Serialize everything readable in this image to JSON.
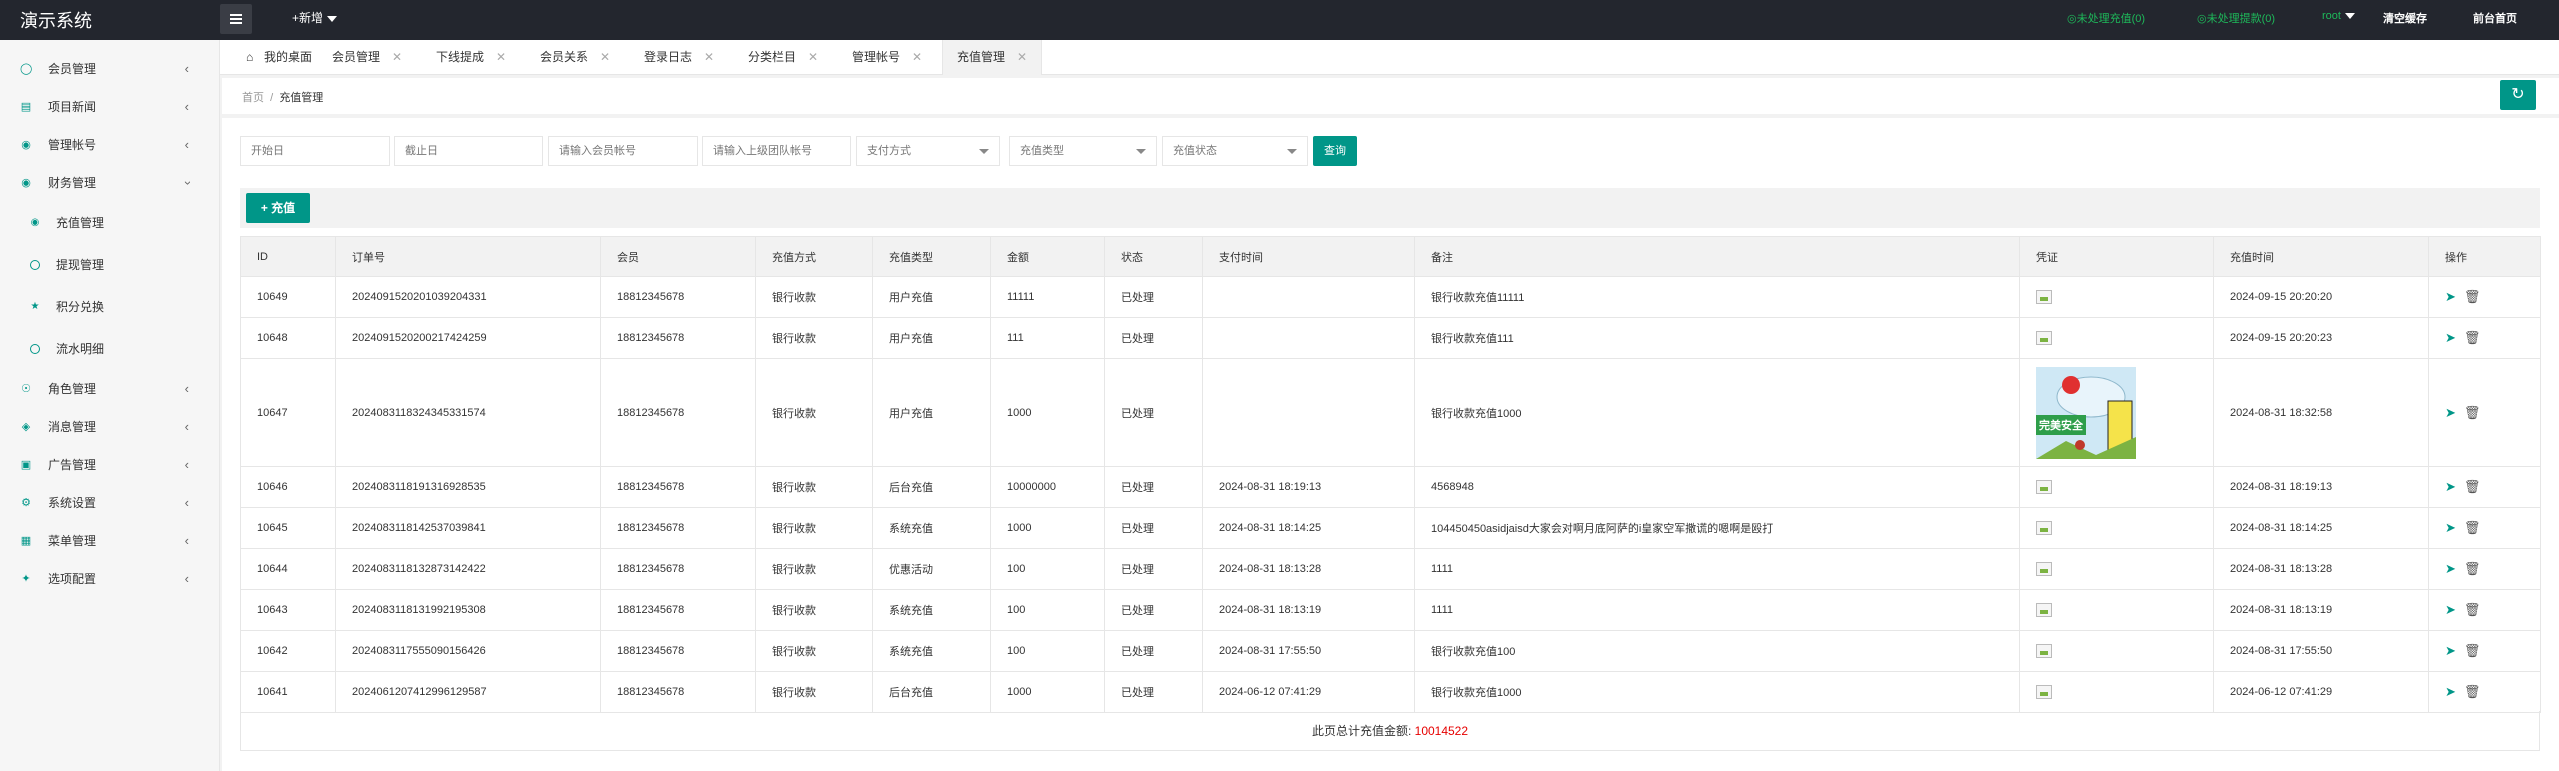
{
  "app": {
    "title": "演示系统"
  },
  "topbar": {
    "add_new": "+新增",
    "unprocessed_recharge": "◎未处理充值(0)",
    "unprocessed_withdraw": "◎未处理提款(0)",
    "user": "root",
    "clear_cache": "清空缓存",
    "frontend_home": "前台首页"
  },
  "sidebar": {
    "items": [
      {
        "label": "会员管理",
        "icon": "user-icon"
      },
      {
        "label": "项目新闻",
        "icon": "book-icon"
      },
      {
        "label": "管理帐号",
        "icon": "account-icon"
      },
      {
        "label": "财务管理",
        "icon": "finance-icon"
      },
      {
        "label": "角色管理",
        "icon": "shield-icon"
      },
      {
        "label": "消息管理",
        "icon": "message-icon"
      },
      {
        "label": "广告管理",
        "icon": "ad-icon"
      },
      {
        "label": "系统设置",
        "icon": "gear-icon"
      },
      {
        "label": "菜单管理",
        "icon": "menu-icon"
      },
      {
        "label": "选项配置",
        "icon": "options-icon"
      }
    ],
    "finance_sub": [
      {
        "label": "充值管理",
        "icon": "recharge-icon"
      },
      {
        "label": "提现管理",
        "icon": "withdraw-icon"
      },
      {
        "label": "积分兑换",
        "icon": "star-icon"
      },
      {
        "label": "流水明细",
        "icon": "flow-icon"
      }
    ]
  },
  "tabs": [
    {
      "label": "我的桌面"
    },
    {
      "label": "会员管理"
    },
    {
      "label": "下线提成"
    },
    {
      "label": "会员关系"
    },
    {
      "label": "登录日志"
    },
    {
      "label": "分类栏目"
    },
    {
      "label": "管理帐号"
    },
    {
      "label": "充值管理"
    }
  ],
  "breadcrumb": {
    "home": "首页",
    "sep": "/",
    "current": "充值管理"
  },
  "filters": {
    "start_date": "开始日",
    "end_date": "截止日",
    "member_account": "请输入会员帐号",
    "parent_account": "请输入上级团队帐号",
    "pay_method": "支付方式",
    "recharge_type": "充值类型",
    "recharge_status": "充值状态",
    "query": "查询"
  },
  "add_button": "充值",
  "table": {
    "headers": [
      "ID",
      "订单号",
      "会员",
      "充值方式",
      "充值类型",
      "金额",
      "状态",
      "支付时间",
      "备注",
      "凭证",
      "充值时间",
      "操作"
    ],
    "rows": [
      {
        "id": "10649",
        "order": "2024091520201039204331",
        "member": "18812345678",
        "method": "银行收款",
        "type": "用户充值",
        "amount": "11111",
        "status": "已处理",
        "pay_time": "",
        "note": "银行收款充值11111",
        "recharge_time": "2024-09-15 20:20:20"
      },
      {
        "id": "10648",
        "order": "2024091520200217424259",
        "member": "18812345678",
        "method": "银行收款",
        "type": "用户充值",
        "amount": "111",
        "status": "已处理",
        "pay_time": "",
        "note": "银行收款充值111",
        "recharge_time": "2024-09-15 20:20:23"
      },
      {
        "id": "10647",
        "order": "2024083118324345331574",
        "member": "18812345678",
        "method": "银行收款",
        "type": "用户充值",
        "amount": "1000",
        "status": "已处理",
        "pay_time": "",
        "note": "银行收款充值1000",
        "recharge_time": "2024-08-31 18:32:58"
      },
      {
        "id": "10646",
        "order": "2024083118191316928535",
        "member": "18812345678",
        "method": "银行收款",
        "type": "后台充值",
        "amount": "10000000",
        "status": "已处理",
        "pay_time": "2024-08-31 18:19:13",
        "note": "4568948",
        "recharge_time": "2024-08-31 18:19:13"
      },
      {
        "id": "10645",
        "order": "2024083118142537039841",
        "member": "18812345678",
        "method": "银行收款",
        "type": "系统充值",
        "amount": "1000",
        "status": "已处理",
        "pay_time": "2024-08-31 18:14:25",
        "note": "104450450asidjaisd大家会对啊月底阿萨的i皇家空军撒谎的嗯啊是殴打",
        "recharge_time": "2024-08-31 18:14:25"
      },
      {
        "id": "10644",
        "order": "2024083118132873142422",
        "member": "18812345678",
        "method": "银行收款",
        "type": "优惠活动",
        "amount": "100",
        "status": "已处理",
        "pay_time": "2024-08-31 18:13:28",
        "note": "1111",
        "recharge_time": "2024-08-31 18:13:28"
      },
      {
        "id": "10643",
        "order": "2024083118131992195308",
        "member": "18812345678",
        "method": "银行收款",
        "type": "系统充值",
        "amount": "100",
        "status": "已处理",
        "pay_time": "2024-08-31 18:13:19",
        "note": "1111",
        "recharge_time": "2024-08-31 18:13:19"
      },
      {
        "id": "10642",
        "order": "2024083117555090156426",
        "member": "18812345678",
        "method": "银行收款",
        "type": "系统充值",
        "amount": "100",
        "status": "已处理",
        "pay_time": "2024-08-31 17:55:50",
        "note": "银行收款充值100",
        "recharge_time": "2024-08-31 17:55:50"
      },
      {
        "id": "10641",
        "order": "2024061207412996129587",
        "member": "18812345678",
        "method": "银行收款",
        "type": "后台充值",
        "amount": "1000",
        "status": "已处理",
        "pay_time": "2024-06-12 07:41:29",
        "note": "银行收款充值1000",
        "recharge_time": "2024-06-12 07:41:29"
      }
    ]
  },
  "voucher_image_text": "完美安全",
  "summary": {
    "label": "此页总计充值金额:",
    "amount": "10014522"
  },
  "colors": {
    "accent": "#009688",
    "topbar": "#23262e",
    "link_green": "#1eb85a",
    "amount_red": "#e60000"
  }
}
